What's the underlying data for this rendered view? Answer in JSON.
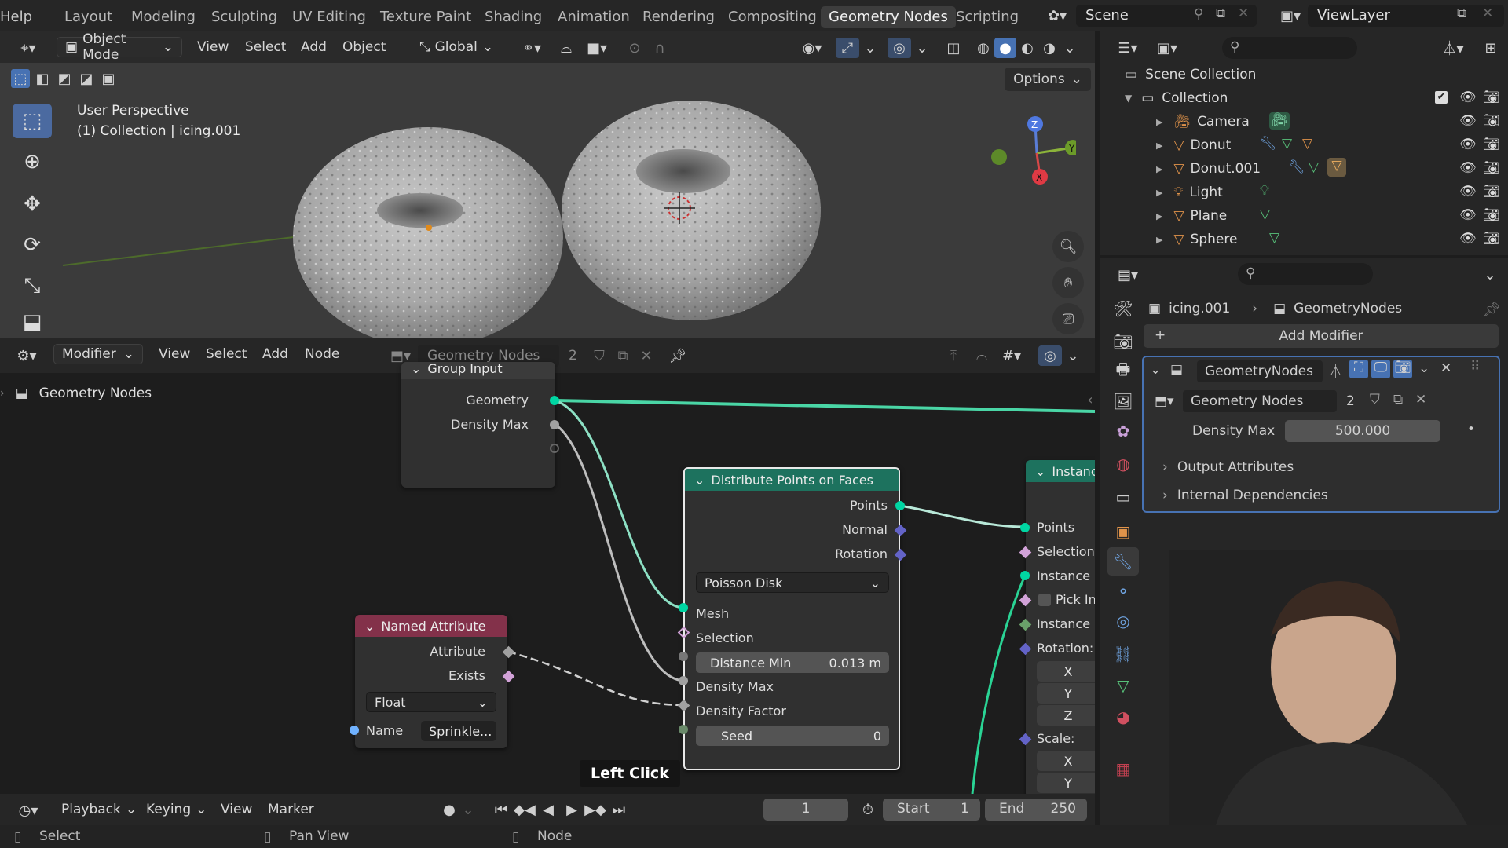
{
  "topbar": {
    "help": "Help",
    "workspaces": [
      "Layout",
      "Modeling",
      "Sculpting",
      "UV Editing",
      "Texture Paint",
      "Shading",
      "Animation",
      "Rendering",
      "Compositing",
      "Geometry Nodes",
      "Scripting"
    ],
    "active_workspace": "Geometry Nodes",
    "scene": "Scene",
    "view_layer": "ViewLayer"
  },
  "viewport": {
    "mode": "Object Mode",
    "menu": [
      "View",
      "Select",
      "Add",
      "Object"
    ],
    "orientation": "Global",
    "options": "Options",
    "overlay_title": "User Perspective",
    "overlay_subtitle": "(1) Collection | icing.001",
    "gizmo": {
      "x": "X",
      "y": "Y",
      "z": "Z"
    }
  },
  "node_editor": {
    "editor": "Modifier",
    "menu": [
      "View",
      "Select",
      "Add",
      "Node"
    ],
    "tree_name": "Geometry Nodes",
    "tree_users": "2",
    "breadcrumb": "Geometry Nodes",
    "group_input": {
      "title": "Group Input",
      "outputs": [
        "Geometry",
        "Density Max"
      ]
    },
    "distribute": {
      "title": "Distribute Points on Faces",
      "outputs": [
        "Points",
        "Normal",
        "Rotation"
      ],
      "method": "Poisson Disk",
      "inputs": [
        "Mesh",
        "Selection"
      ],
      "distance_min_label": "Distance Min",
      "distance_min_value": "0.013 m",
      "density_max": "Density Max",
      "density_factor": "Density Factor",
      "seed_label": "Seed",
      "seed_value": "0"
    },
    "named_attribute": {
      "title": "Named Attribute",
      "outputs": [
        "Attribute",
        "Exists"
      ],
      "type": "Float",
      "name_label": "Name",
      "name_value": "Sprinkle..."
    },
    "instance": {
      "title": "Instanc",
      "points": "Points",
      "selection": "Selection",
      "instance": "Instance",
      "pick": "Pick In",
      "instance_index": "Instance I",
      "rotation": "Rotation:",
      "x": "X",
      "y": "Y",
      "z": "Z",
      "scale": "Scale:",
      "sx": "X",
      "sy": "Y"
    },
    "tooltip": "Left Click"
  },
  "timeline": {
    "menu": [
      "Playback",
      "Keying",
      "View",
      "Marker"
    ],
    "current_frame": "1",
    "start_label": "Start",
    "start": "1",
    "end_label": "End",
    "end": "250"
  },
  "statusbar": {
    "items": [
      "Select",
      "Pan View",
      "Node"
    ]
  },
  "outliner": {
    "root": "Scene Collection",
    "collection": "Collection",
    "objects": [
      "Camera",
      "Donut",
      "Donut.001",
      "Light",
      "Plane",
      "Sphere"
    ]
  },
  "properties": {
    "object": "icing.001",
    "modifier_crumb": "GeometryNodes",
    "add_modifier": "Add Modifier",
    "modifier_name": "GeometryNodes",
    "node_group": "Geometry Nodes",
    "node_group_users": "2",
    "density_max_label": "Density Max",
    "density_max_value": "500.000",
    "panels": [
      "Output Attributes",
      "Internal Dependencies"
    ]
  },
  "colors": {
    "geometry_socket": "#00d6a3",
    "float_socket": "#a1a1a1",
    "vector_socket": "#6363c7",
    "named_attr_header": "#83314a",
    "distribute_header": "#1d725e",
    "accent": "#4772b3"
  }
}
